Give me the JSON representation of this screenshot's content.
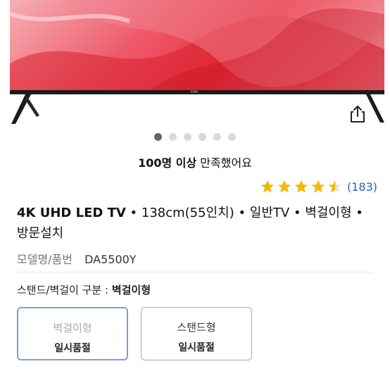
{
  "product_image": {
    "brand_mark": "AIWA",
    "share_icon": "share-icon"
  },
  "carousel": {
    "count": 6,
    "active": 1
  },
  "satisfaction": {
    "bold": "100명 이상",
    "rest": " 만족했어요"
  },
  "rating": {
    "value": 4.5,
    "count": "(183)",
    "star_color": "#f5b800"
  },
  "title": {
    "bold": "4K UHD LED TV",
    "rest": " • 138cm(55인치) • 일반TV • 벽걸이형 • 방문설치"
  },
  "model": {
    "label": "모델명/품번",
    "value": "DA5500Y"
  },
  "option": {
    "label": "스탠드/벽걸이 구분 : ",
    "selected": "벽걸이형",
    "choices": [
      {
        "name": "벽걸이형",
        "status": "일시품절"
      },
      {
        "name": "스탠드형",
        "status": "일시품절"
      }
    ]
  }
}
